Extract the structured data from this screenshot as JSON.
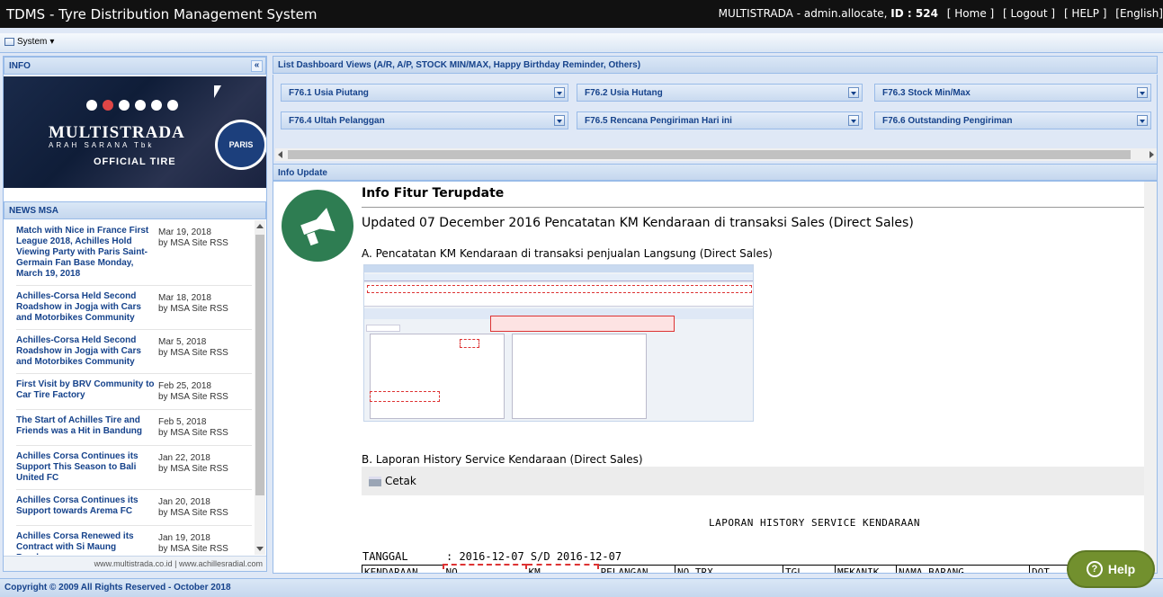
{
  "app": {
    "title": "TDMS - Tyre Distribution Management System",
    "user_info": "MULTISTRADA - admin.allocate,",
    "id_label": "ID : 524",
    "nav": [
      "[ Home ]",
      "[ Logout ]",
      "[ HELP ]",
      "[English]"
    ]
  },
  "menubar": {
    "system_label": "System"
  },
  "left": {
    "info_header": "INFO",
    "banner": {
      "brand": "MULTISTRADA",
      "tagline": "ARAH SARANA Tbk",
      "official": "OFFICIAL TIRE",
      "club": "PARIS"
    },
    "news_header": "NEWS MSA",
    "news": [
      {
        "title": "Match with Nice in France First League 2018, Achilles Hold Viewing Party with Paris Saint-Germain Fan Base Monday, March 19, 2018",
        "date": "Mar 19, 2018",
        "by": "by MSA Site RSS"
      },
      {
        "title": "Achilles-Corsa Held Second Roadshow in Jogja with Cars and Motorbikes Community",
        "date": "Mar 18, 2018",
        "by": "by MSA Site RSS"
      },
      {
        "title": "Achilles-Corsa Held Second Roadshow in Jogja with Cars and Motorbikes Community",
        "date": "Mar 5, 2018",
        "by": "by MSA Site RSS"
      },
      {
        "title": "First Visit by BRV Community to Car Tire Factory",
        "date": "Feb 25, 2018",
        "by": "by MSA Site RSS"
      },
      {
        "title": "The Start of Achilles Tire and Friends was a Hit in Bandung",
        "date": "Feb 5, 2018",
        "by": "by MSA Site RSS"
      },
      {
        "title": "Achilles Corsa Continues its Support This Season to Bali United FC",
        "date": "Jan 22, 2018",
        "by": "by MSA Site RSS"
      },
      {
        "title": "Achilles Corsa Continues its Support towards Arema FC",
        "date": "Jan 20, 2018",
        "by": "by MSA Site RSS"
      },
      {
        "title": "Achilles Corsa Renewed its Contract with Si Maung Bandung",
        "date": "Jan 19, 2018",
        "by": "by MSA Site RSS"
      }
    ],
    "sites": "www.multistrada.co.id | www.achillesradial.com"
  },
  "dashboard": {
    "header": "List Dashboard Views (A/R, A/P, STOCK MIN/MAX, Happy Birthday Reminder, Others)",
    "buttons": [
      "F76.1 Usia Piutang",
      "F76.2 Usia Hutang",
      "F76.3 Stock Min/Max",
      "F76.4 Ultah Pelanggan",
      "F76.5 Rencana Pengiriman Hari ini",
      "F76.6 Outstanding Pengiriman"
    ]
  },
  "update": {
    "header": "Info Update",
    "title": "Info Fitur Terupdate",
    "updated": "Updated 07 December 2016 Pencatatan KM Kendaraan di transaksi Sales (Direct Sales)",
    "section_a": "A. Pencatatan KM Kendaraan di transaksi penjualan Langsung (Direct Sales)",
    "section_b": "B. Laporan History Service Kendaraan (Direct Sales)",
    "cetak": "Cetak",
    "report_title": "LAPORAN HISTORY SERVICE KENDARAAN",
    "tanggal_label": "TANGGAL",
    "tanggal_value": ": 2016-12-07 S/D 2016-12-07",
    "columns": [
      "KENDARAAN",
      "NO.",
      "KM",
      "PELANGAN",
      "NO.TRX",
      "TGL.",
      "MEKANIK",
      "NAMA BARANG",
      "DOT"
    ]
  },
  "footer": {
    "copyright": "Copyright © 2009 All Rights Reserved - October 2018"
  },
  "help": {
    "label": "Help"
  }
}
